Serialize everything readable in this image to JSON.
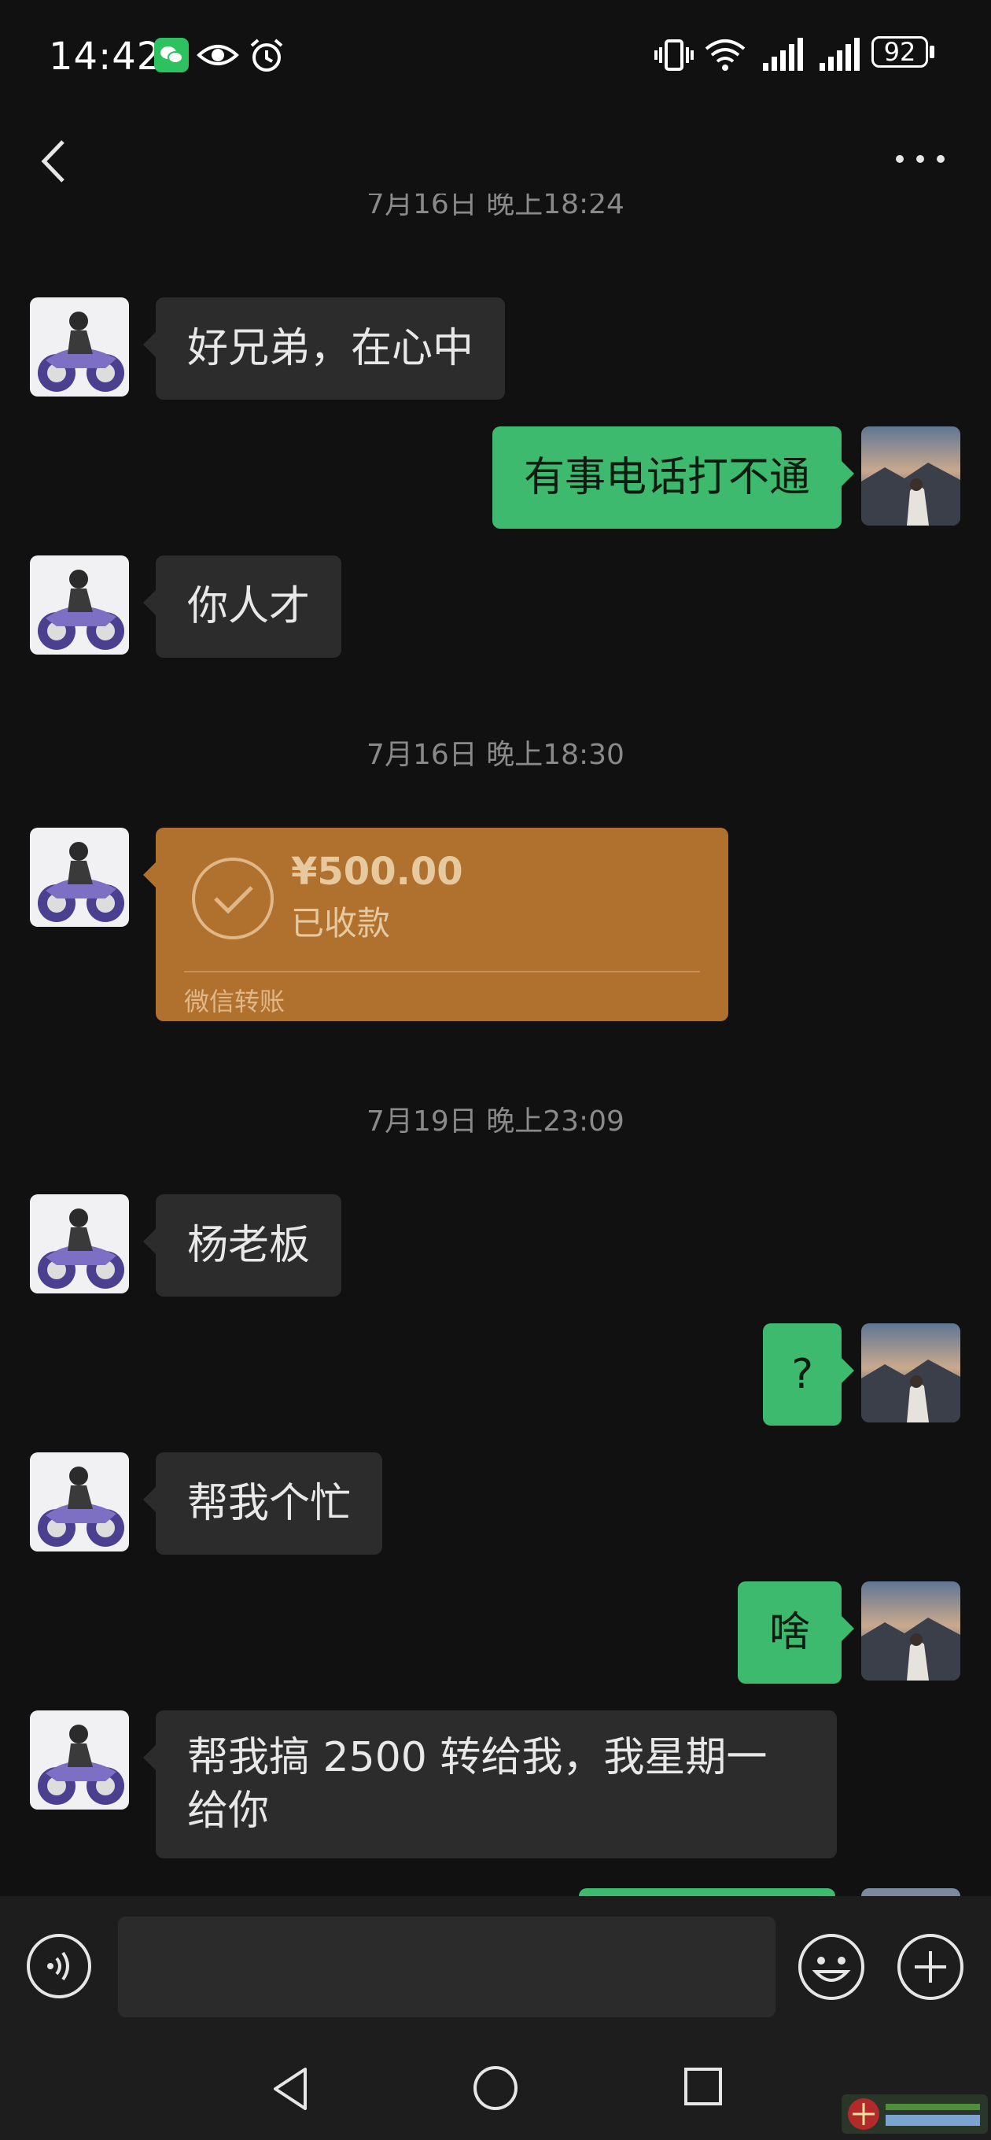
{
  "status_bar": {
    "time": "14:42",
    "battery": "92",
    "icons": [
      "wechat-notification-icon",
      "eye-icon",
      "alarm-icon",
      "vibrate-icon",
      "wifi-icon",
      "signal-icon",
      "signal-icon",
      "battery-icon"
    ]
  },
  "header": {
    "back_icon": "back-chevron-icon",
    "more_icon": "more-dots-icon"
  },
  "timestamps": {
    "t1": "7月16日 晚上18:24",
    "t2": "7月16日 晚上18:30",
    "t3": "7月19日 晚上23:09"
  },
  "messages": [
    {
      "side": "in",
      "text": "好兄弟，在心中"
    },
    {
      "side": "out",
      "text": "有事电话打不通"
    },
    {
      "side": "in",
      "text": "你人才"
    },
    {
      "side": "in",
      "type": "transfer",
      "amount": "¥500.00",
      "status": "已收款",
      "caption": "微信转账"
    },
    {
      "side": "in",
      "text": "杨老板"
    },
    {
      "side": "out",
      "text": "?"
    },
    {
      "side": "in",
      "text": "帮我个忙"
    },
    {
      "side": "out",
      "text": "啥"
    },
    {
      "side": "in",
      "text": "帮我搞 2500 转给我，我星期一给你"
    }
  ],
  "input_bar": {
    "voice_icon": "voice-icon",
    "input_value": "",
    "emoji_icon": "emoji-icon",
    "plus_icon": "plus-icon"
  },
  "nav_bar": {
    "icons": [
      "nav-back-icon",
      "nav-home-icon",
      "nav-recent-icon"
    ]
  },
  "colors": {
    "background": "#111111",
    "incoming_bubble": "#2c2c2c",
    "outgoing_bubble": "#3dba6e",
    "transfer_card": "#b1712e"
  }
}
